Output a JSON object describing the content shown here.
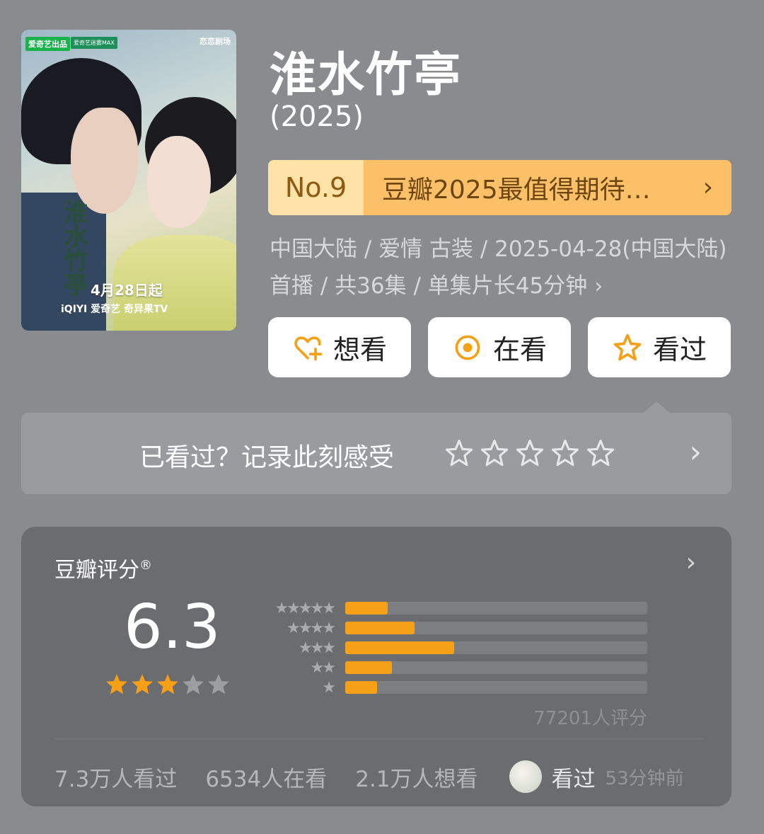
{
  "poster": {
    "badge_left": "爱奇艺出品",
    "badge_mid": "爱奇艺迷雾MAX",
    "badge_right": "恋恋剧场",
    "calligraphy": "淮水竹亭",
    "date_text": "4月28日起",
    "platforms": "iQIYI 爱奇艺  奇异果TV"
  },
  "title": "淮水竹亭",
  "year": "(2025)",
  "ranking": {
    "no": "No.9",
    "text": "豆瓣2025最值得期待…"
  },
  "meta": "中国大陆 / 爱情 古装 / 2025-04-28(中国大陆)首播 / 共36集 / 单集片长45分钟",
  "actions": {
    "want": "想看",
    "watching": "在看",
    "watched": "看过"
  },
  "record": {
    "prompt": "已看过？记录此刻感受"
  },
  "rating": {
    "label": "豆瓣评分",
    "reg_mark": "®",
    "score": "6.3",
    "stars": 3,
    "distribution": [
      {
        "stars": "★★★★★",
        "fraction": 0.14
      },
      {
        "stars": "★★★★",
        "fraction": 0.23
      },
      {
        "stars": "★★★",
        "fraction": 0.36
      },
      {
        "stars": "★★",
        "fraction": 0.155
      },
      {
        "stars": "★",
        "fraction": 0.105
      }
    ],
    "count": "77201人评分"
  },
  "footer": {
    "watched": "7.3万人看过",
    "watching": "6534人在看",
    "want": "2.1万人想看",
    "friend_status": "看过",
    "friend_time": "53分钟前"
  },
  "colors": {
    "background": "#8a8b8f",
    "accent_orange": "#f5a016",
    "rank_no_bg": "#ffe2a6",
    "rank_text_bg": "#fbc068",
    "card_bg": "#6b6c70"
  }
}
